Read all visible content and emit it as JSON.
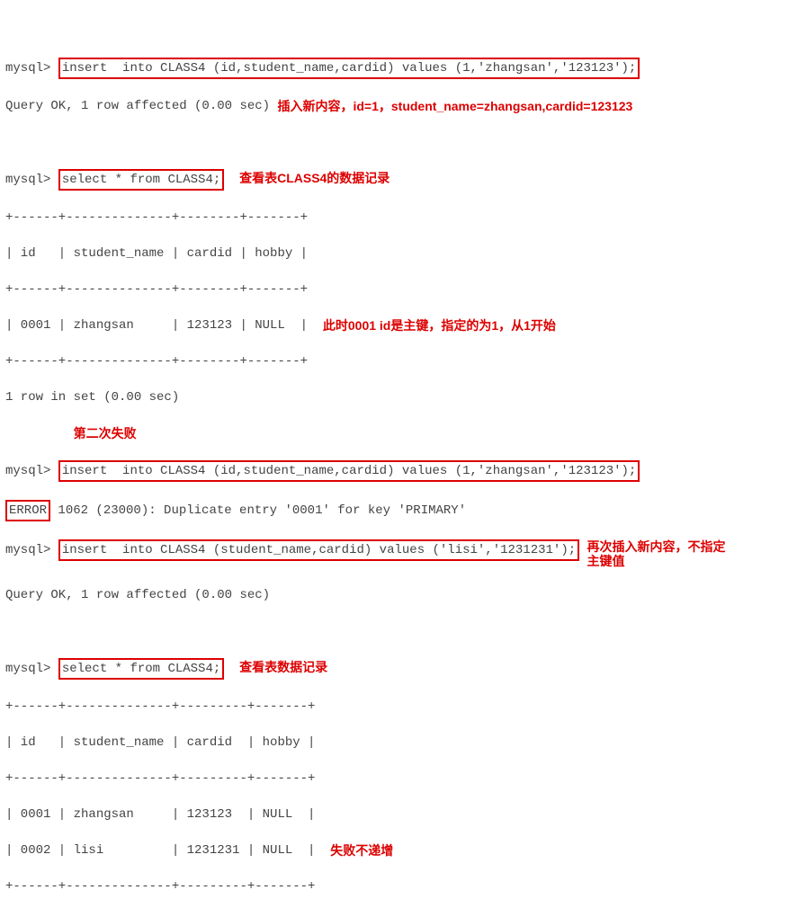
{
  "prompt": "mysql>",
  "cmd1": "insert  into CLASS4 (id,student_name,cardid) values (1,'zhangsan','123123');",
  "ok1": "Query OK, 1 row affected (0.00 sec)",
  "ann1": "插入新内容，id=1，student_name=zhangsan,cardid=123123",
  "cmd2": "select * from CLASS4;",
  "ann2": "查看表CLASS4的数据记录",
  "table1": {
    "border": "+------+--------------+--------+-------+",
    "header": "| id   | student_name | cardid | hobby |",
    "row1": "| 0001 | zhangsan     | 123123 | NULL  |"
  },
  "ann3": "此时0001  id是主键，指定的为1，从1开始",
  "rows1": "1 row in set (0.00 sec)",
  "ann4": "第二次失败",
  "cmd3": "insert  into CLASS4 (id,student_name,cardid) values (1,'zhangsan','123123');",
  "err": "ERROR",
  "errmsg": "1062 (23000): Duplicate entry '0001' for key 'PRIMARY'",
  "cmd4": "insert  into CLASS4 (student_name,cardid) values ('lisi','1231231');",
  "ann5a": "再次插入新内容，不指定",
  "ann5b": "主键值",
  "ok2": "Query OK, 1 row affected (0.00 sec)",
  "cmd5": "select * from CLASS4;",
  "ann6": "查看表数据记录",
  "table2": {
    "border": "+------+--------------+---------+-------+",
    "header": "| id   | student_name | cardid  | hobby |",
    "row1": "| 0001 | zhangsan     | 123123  | NULL  |",
    "row2": "| 0002 | lisi         | 1231231 | NULL  |"
  },
  "ann7": "失败不递增",
  "chart_data": {
    "type": "table",
    "tables": [
      {
        "columns": [
          "id",
          "student_name",
          "cardid",
          "hobby"
        ],
        "rows": [
          [
            "0001",
            "zhangsan",
            "123123",
            "NULL"
          ]
        ]
      },
      {
        "columns": [
          "id",
          "student_name",
          "cardid",
          "hobby"
        ],
        "rows": [
          [
            "0001",
            "zhangsan",
            "123123",
            "NULL"
          ],
          [
            "0002",
            "lisi",
            "1231231",
            "NULL"
          ]
        ]
      }
    ]
  }
}
